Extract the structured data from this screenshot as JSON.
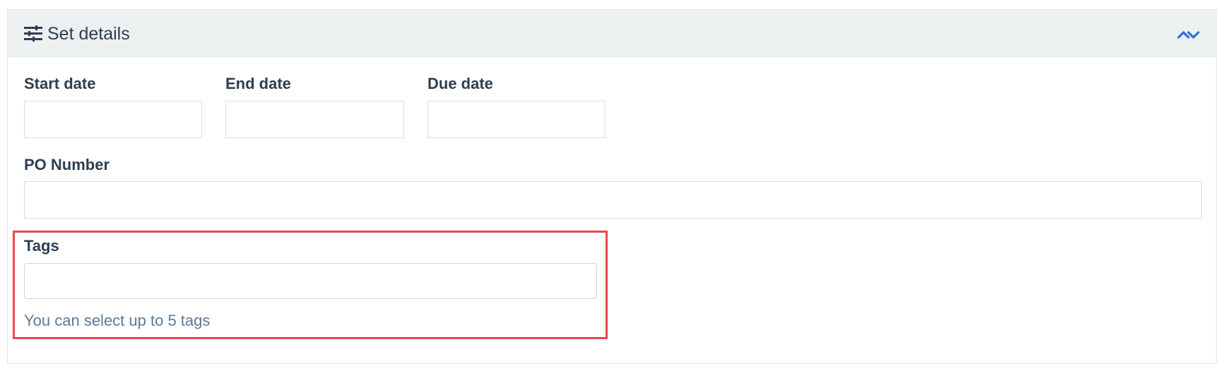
{
  "panel": {
    "title": "Set details",
    "header_icon": "sliders-icon",
    "toggle_icon": "double-chevron-up-icon"
  },
  "fields": {
    "start_date": {
      "label": "Start date",
      "value": "",
      "placeholder": ""
    },
    "end_date": {
      "label": "End date",
      "value": "",
      "placeholder": ""
    },
    "due_date": {
      "label": "Due date",
      "value": "",
      "placeholder": ""
    },
    "po_number": {
      "label": "PO Number",
      "value": "",
      "placeholder": ""
    },
    "tags": {
      "label": "Tags",
      "value": "",
      "placeholder": "",
      "hint": "You can select up to 5 tags"
    }
  },
  "colors": {
    "header_bg": "#ecf0f1",
    "text": "#2d3e50",
    "accent": "#2f6fd6",
    "hint": "#5b7a9a",
    "highlight": "#e8474f"
  }
}
